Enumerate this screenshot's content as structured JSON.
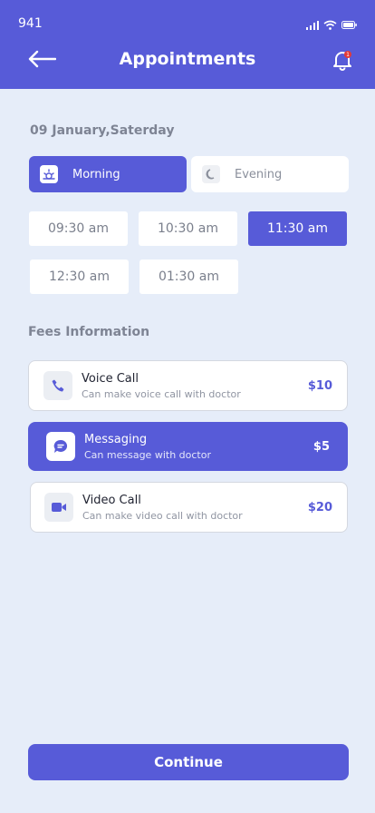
{
  "status": {
    "time": "941"
  },
  "header": {
    "title": "Appointments",
    "notification_count": "1"
  },
  "date": "09 January,Saterday",
  "periods": [
    {
      "label": "Morning",
      "icon": "sun-icon",
      "active": true
    },
    {
      "label": "Evening",
      "icon": "moon-icon",
      "active": false
    }
  ],
  "slots": [
    "09:30 am",
    "10:30 am",
    "11:30 am",
    "12:30 am",
    "01:30 am"
  ],
  "selected_slot": "11:30 am",
  "fees": {
    "title": "Fees Information",
    "items": [
      {
        "name": "Voice Call",
        "desc": "Can make voice call with doctor",
        "price": "$10",
        "icon": "phone-icon"
      },
      {
        "name": "Messaging",
        "desc": "Can message with doctor",
        "price": "$5",
        "icon": "chat-icon"
      },
      {
        "name": "Video Call",
        "desc": "Can make video call with doctor",
        "price": "$20",
        "icon": "video-icon"
      }
    ],
    "selected": "Messaging"
  },
  "continue_label": "Continue",
  "colors": {
    "accent": "#575BD8",
    "background": "#E6EDF9"
  }
}
